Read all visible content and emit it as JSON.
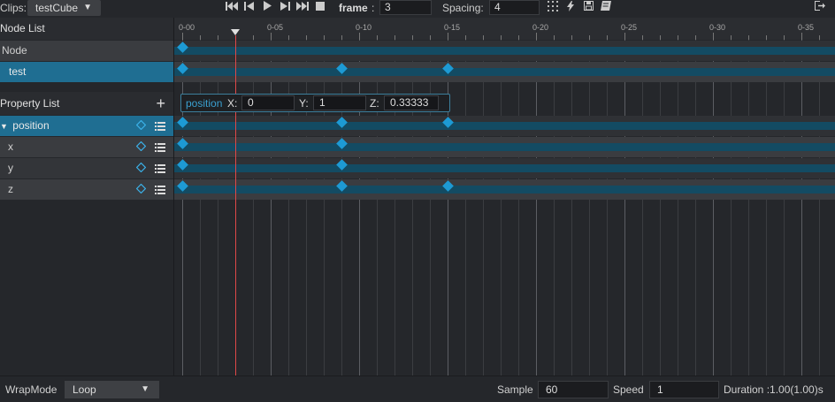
{
  "toolbar": {
    "clips_label": "Clips:",
    "clip_name": "testCube",
    "frame_label": "frame",
    "frame_colon": ":",
    "frame_value": "3",
    "spacing_label": "Spacing:",
    "spacing_value": "4"
  },
  "node_list": {
    "header": "Node List",
    "items": [
      {
        "label": "Node"
      },
      {
        "label": "test"
      }
    ]
  },
  "property_list": {
    "header": "Property List",
    "items": [
      {
        "label": "position"
      },
      {
        "label": "x"
      },
      {
        "label": "y"
      },
      {
        "label": "z"
      }
    ]
  },
  "ruler": {
    "ticks": [
      "0-00",
      "0-05",
      "0-10",
      "0-15",
      "0-20",
      "0-25",
      "0-30",
      "0-35"
    ]
  },
  "editor": {
    "property": "position",
    "x_label": "X:",
    "x_value": "0",
    "y_label": "Y:",
    "y_value": "1",
    "z_label": "Z:",
    "z_value": "0.33333"
  },
  "footer": {
    "wrapmode_label": "WrapMode",
    "wrapmode_value": "Loop",
    "sample_label": "Sample",
    "sample_value": "60",
    "speed_label": "Speed",
    "speed_value": "1",
    "duration_text": "Duration :1.00(1.00)s"
  },
  "colors": {
    "accent": "#1d9ad4",
    "selected_row": "#1f6e92",
    "playhead": "#e04848"
  },
  "keyframes": {
    "playhead_frame": 3,
    "node_row": [
      0
    ],
    "test_row": [
      0,
      9,
      15
    ],
    "position_row": [
      0,
      9,
      15
    ],
    "x_row": [
      0,
      9
    ],
    "y_row": [
      0,
      9
    ],
    "z_row": [
      0,
      9,
      15
    ]
  }
}
